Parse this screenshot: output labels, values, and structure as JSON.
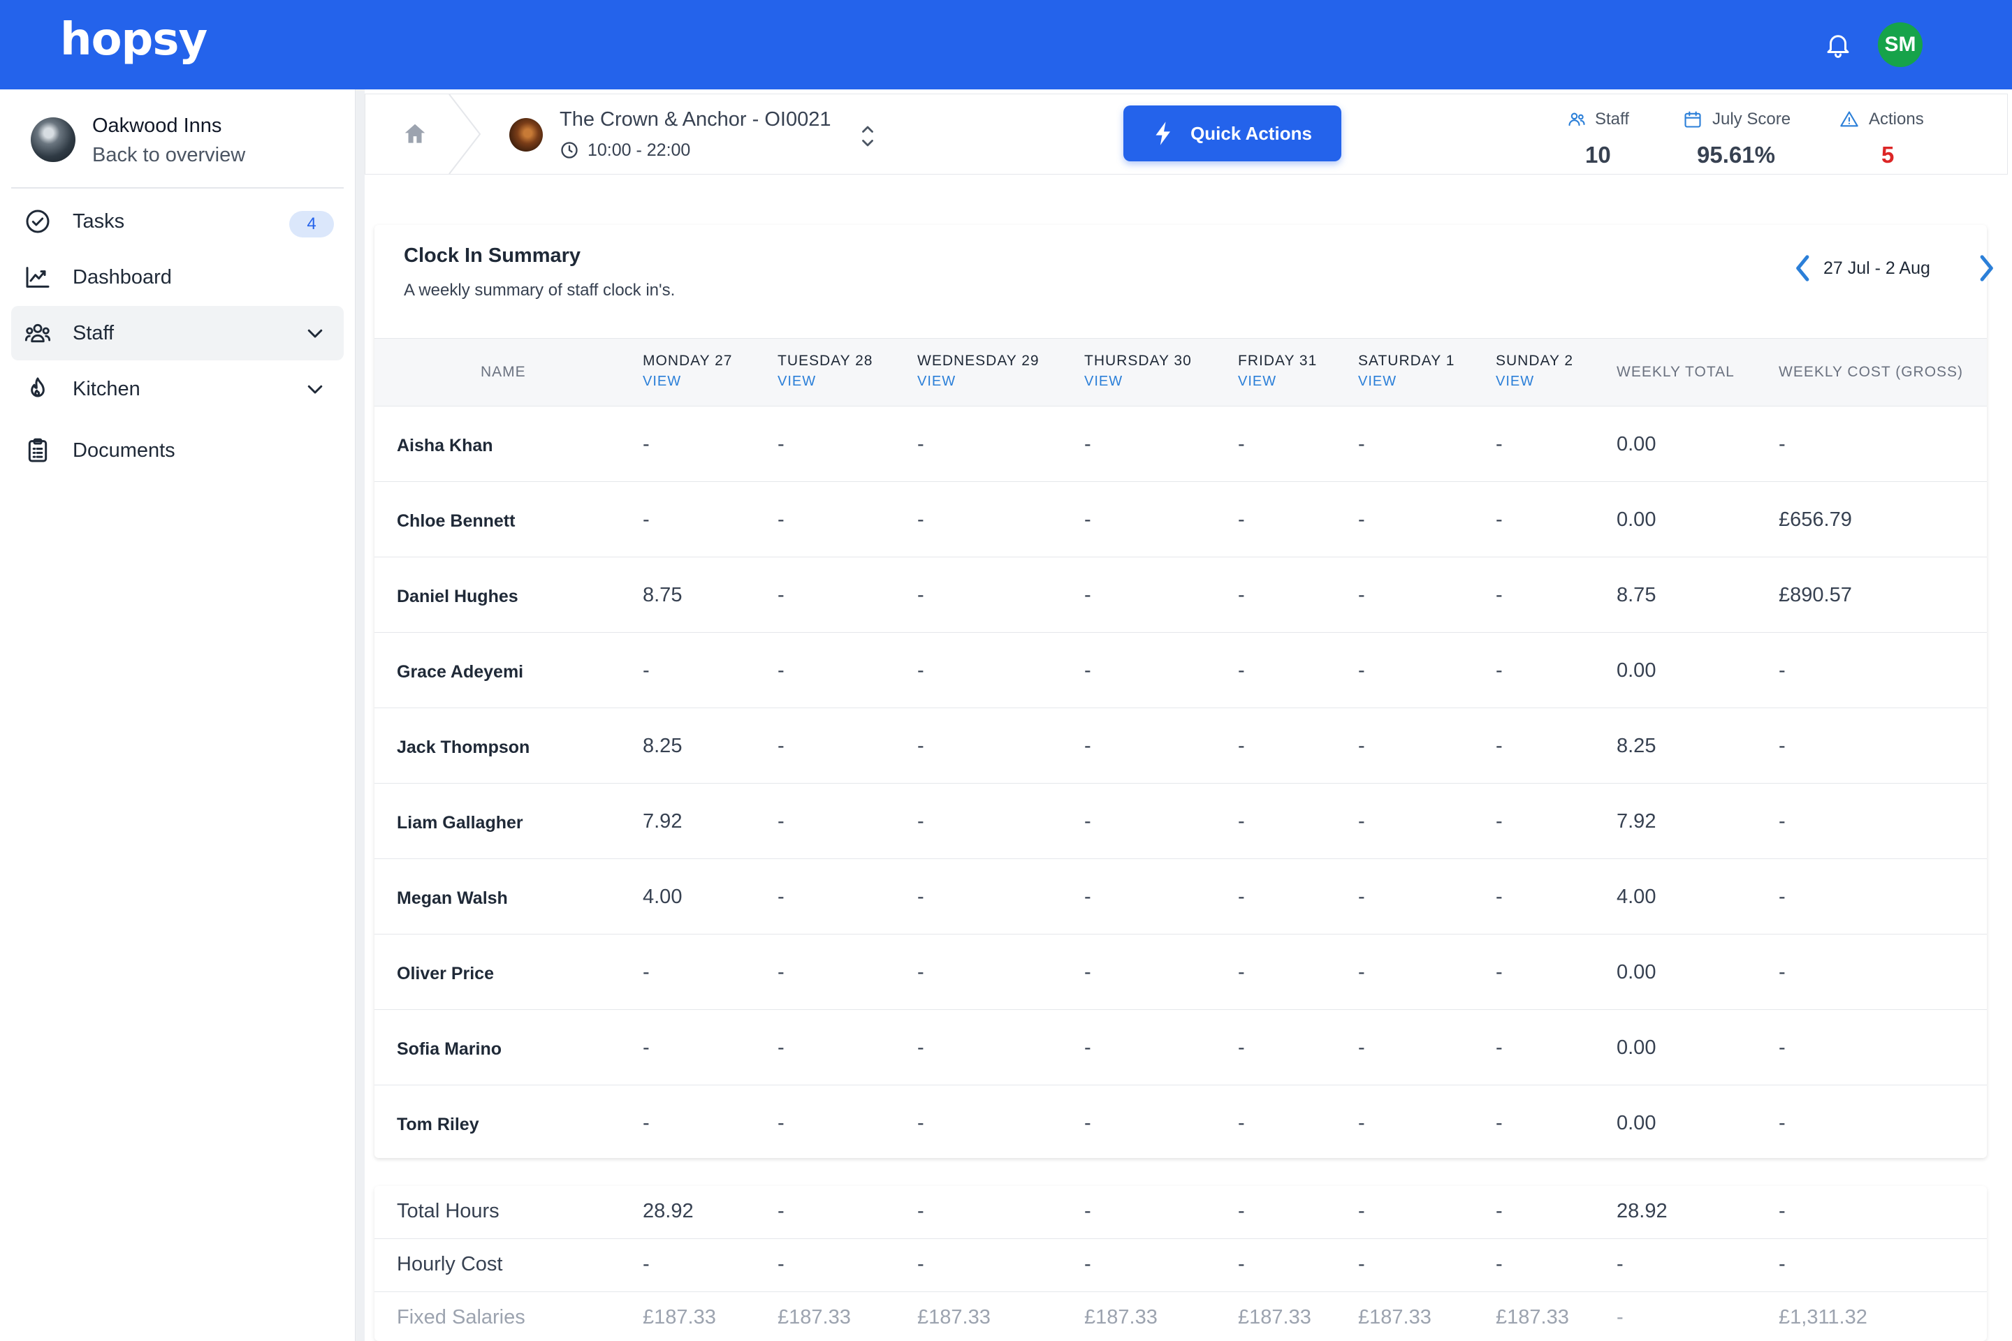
{
  "header": {
    "logo": "hopsy",
    "user_initials": "SM",
    "accent_color": "#2463eb"
  },
  "sidebar": {
    "org_name": "Oakwood Inns",
    "back_label": "Back to overview",
    "items": [
      {
        "label": "Tasks",
        "icon": "check-circle-icon",
        "badge": "4"
      },
      {
        "label": "Dashboard",
        "icon": "chart-line-icon"
      },
      {
        "label": "Staff",
        "icon": "users-icon"
      },
      {
        "label": "Kitchen",
        "icon": "flame-icon"
      },
      {
        "label": "Documents",
        "icon": "clipboard-icon"
      }
    ]
  },
  "location": {
    "name": "The Crown & Anchor - OI0021",
    "hours": "10:00 - 22:00",
    "quick_actions_label": "Quick Actions",
    "stats": [
      {
        "label": "Staff",
        "value": "10",
        "icon": "users-icon"
      },
      {
        "label": "July Score",
        "value": "95.61%",
        "icon": "calendar-icon"
      },
      {
        "label": "Actions",
        "value": "5",
        "icon": "warning-icon",
        "value_color": "#dc2626"
      }
    ]
  },
  "clockin": {
    "title": "Clock In Summary",
    "subtitle": "A weekly summary of staff clock in's.",
    "week_label": "27 Jul - 2 Aug",
    "columns": {
      "name": "NAME",
      "days": [
        "MONDAY 27",
        "TUESDAY 28",
        "WEDNESDAY 29",
        "THURSDAY 30",
        "FRIDAY 31",
        "SATURDAY 1",
        "SUNDAY 2"
      ],
      "view_label": "VIEW",
      "weekly_total": "WEEKLY TOTAL",
      "weekly_cost": "WEEKLY COST (GROSS)"
    },
    "rows": [
      {
        "name": "Aisha Khan",
        "days": [
          "-",
          "-",
          "-",
          "-",
          "-",
          "-",
          "-"
        ],
        "total": "0.00",
        "cost": "-"
      },
      {
        "name": "Chloe Bennett",
        "days": [
          "-",
          "-",
          "-",
          "-",
          "-",
          "-",
          "-"
        ],
        "total": "0.00",
        "cost": "£656.79"
      },
      {
        "name": "Daniel Hughes",
        "days": [
          "8.75",
          "-",
          "-",
          "-",
          "-",
          "-",
          "-"
        ],
        "total": "8.75",
        "cost": "£890.57"
      },
      {
        "name": "Grace Adeyemi",
        "days": [
          "-",
          "-",
          "-",
          "-",
          "-",
          "-",
          "-"
        ],
        "total": "0.00",
        "cost": "-"
      },
      {
        "name": "Jack Thompson",
        "days": [
          "8.25",
          "-",
          "-",
          "-",
          "-",
          "-",
          "-"
        ],
        "total": "8.25",
        "cost": "-"
      },
      {
        "name": "Liam Gallagher",
        "days": [
          "7.92",
          "-",
          "-",
          "-",
          "-",
          "-",
          "-"
        ],
        "total": "7.92",
        "cost": "-"
      },
      {
        "name": "Megan Walsh",
        "days": [
          "4.00",
          "-",
          "-",
          "-",
          "-",
          "-",
          "-"
        ],
        "total": "4.00",
        "cost": "-"
      },
      {
        "name": "Oliver Price",
        "days": [
          "-",
          "-",
          "-",
          "-",
          "-",
          "-",
          "-"
        ],
        "total": "0.00",
        "cost": "-"
      },
      {
        "name": "Sofia Marino",
        "days": [
          "-",
          "-",
          "-",
          "-",
          "-",
          "-",
          "-"
        ],
        "total": "0.00",
        "cost": "-"
      },
      {
        "name": "Tom Riley",
        "days": [
          "-",
          "-",
          "-",
          "-",
          "-",
          "-",
          "-"
        ],
        "total": "0.00",
        "cost": "-"
      }
    ]
  },
  "summary": {
    "rows": [
      {
        "label": "Total Hours",
        "days": [
          "28.92",
          "-",
          "-",
          "-",
          "-",
          "-",
          "-"
        ],
        "total": "28.92",
        "cost": "-"
      },
      {
        "label": "Hourly Cost",
        "days": [
          "-",
          "-",
          "-",
          "-",
          "-",
          "-",
          "-"
        ],
        "total": "-",
        "cost": "-"
      },
      {
        "label": "Fixed Salaries",
        "days": [
          "£187.33",
          "£187.33",
          "£187.33",
          "£187.33",
          "£187.33",
          "£187.33",
          "£187.33"
        ],
        "total": "-",
        "cost": "£1,311.32"
      }
    ]
  }
}
